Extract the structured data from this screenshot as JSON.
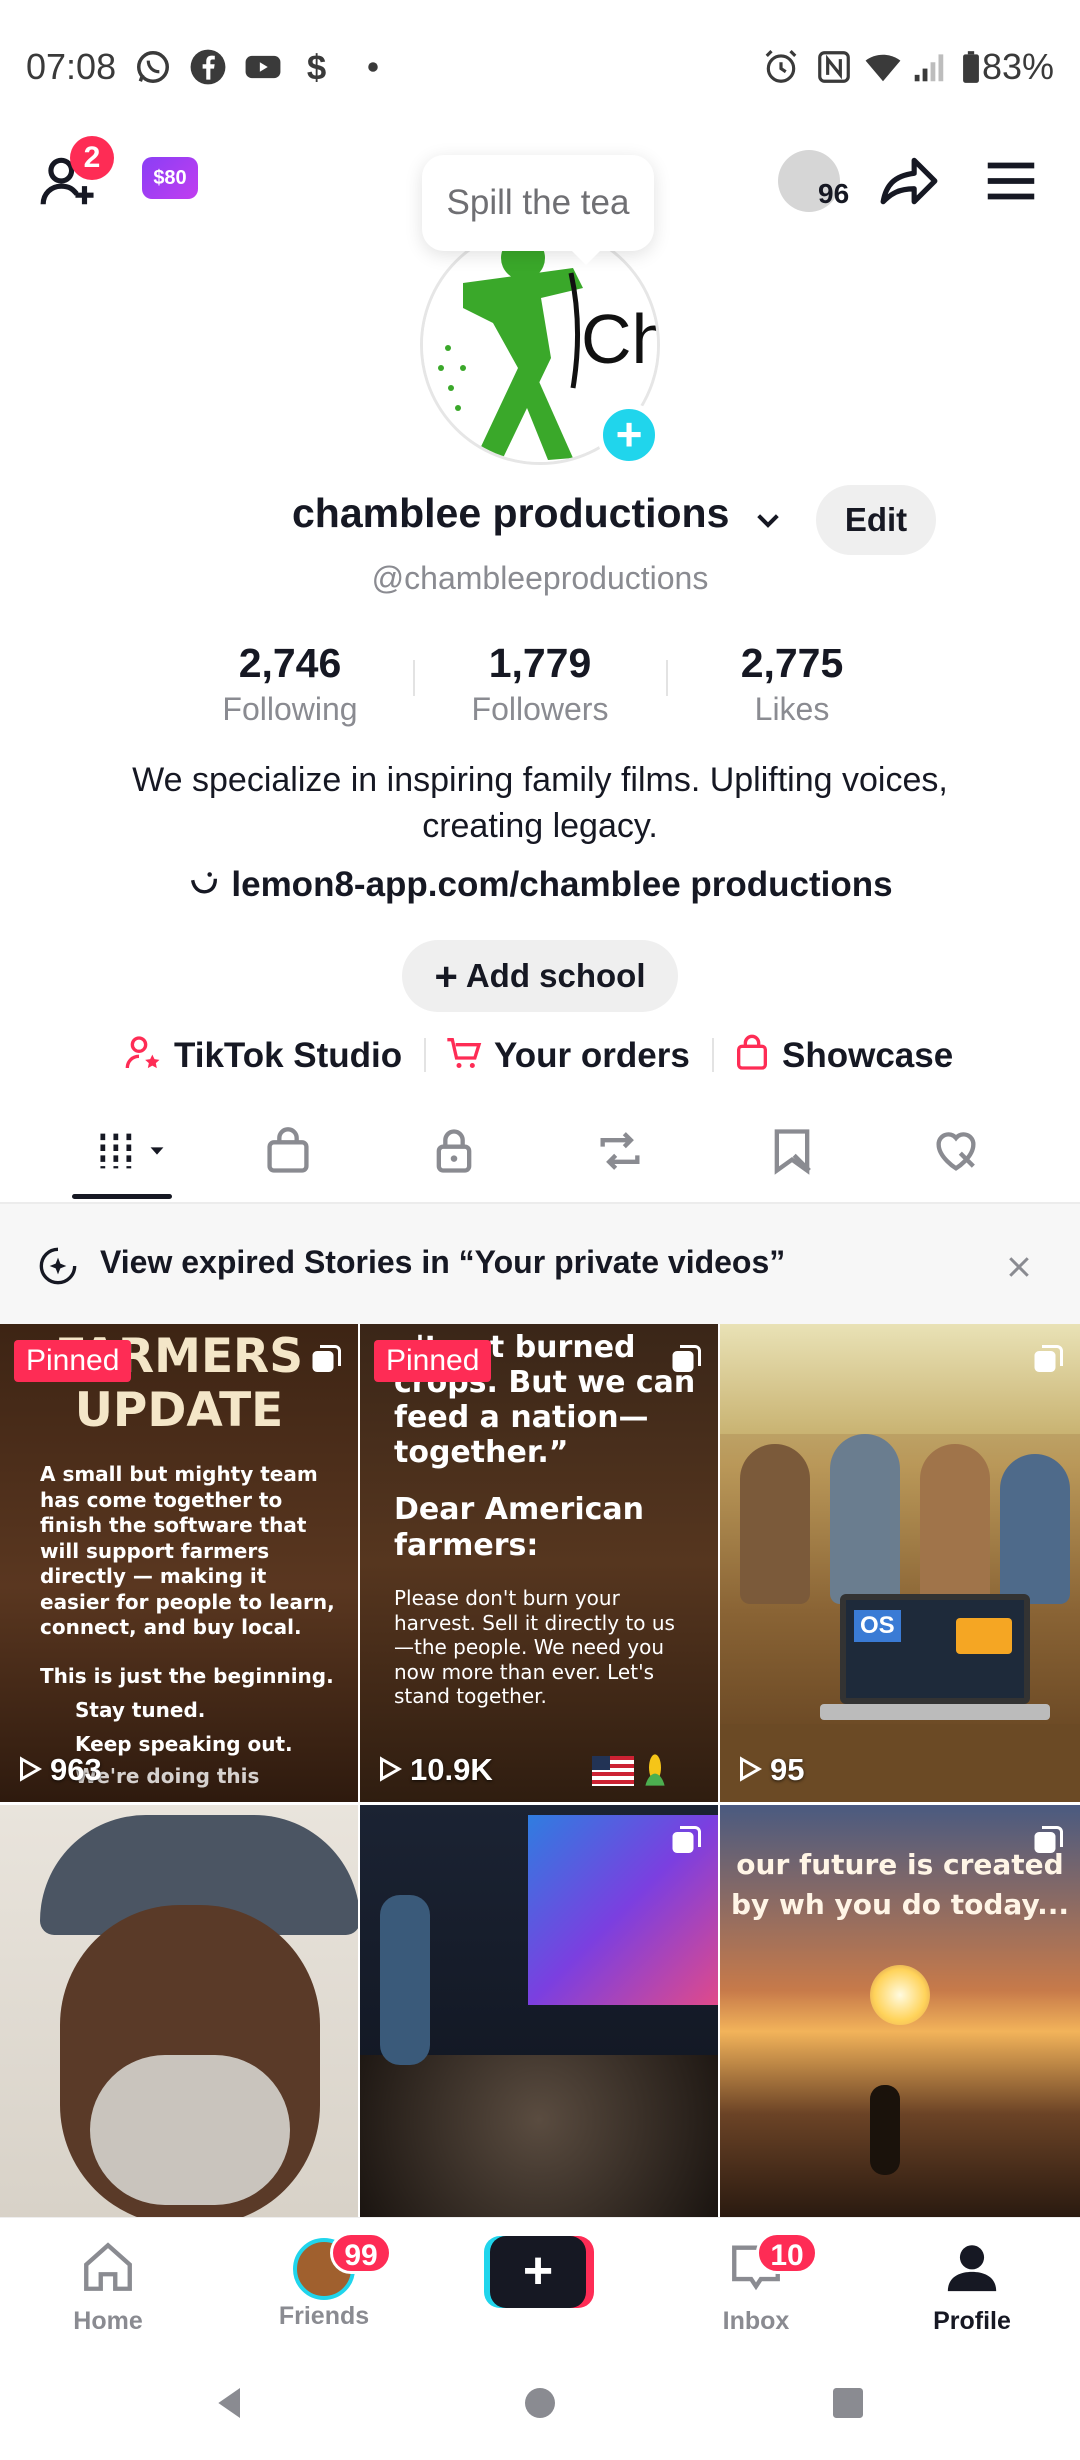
{
  "status_bar": {
    "time": "07:08",
    "battery": "83%"
  },
  "header": {
    "add_friends_badge": "2",
    "coin_badge": "$80",
    "views_count": "96",
    "tooltip": "Spill the tea"
  },
  "profile": {
    "name": "chamblee productions",
    "edit_label": "Edit",
    "handle": "@chambleeproductions",
    "stats": [
      {
        "value": "2,746",
        "label": "Following"
      },
      {
        "value": "1,779",
        "label": "Followers"
      },
      {
        "value": "2,775",
        "label": "Likes"
      }
    ],
    "bio": "We specialize in inspiring family films. Uplifting voices, creating legacy.",
    "link": "lemon8-app.com/chamblee productions",
    "add_school": "Add school",
    "quick_links": [
      "TikTok Studio",
      "Your orders",
      "Showcase"
    ]
  },
  "tabs": [
    "videos-grid-icon",
    "shop-bag-icon",
    "lock-icon",
    "repost-icon",
    "favorites-icon",
    "liked-hidden-icon"
  ],
  "notice": {
    "text": "View expired Stories in “Your private videos”"
  },
  "videos": [
    {
      "pinned": "Pinned",
      "views": "963",
      "headline": "FARMERS UPDATE",
      "body": "A small but mighty team has come together to finish the software that will support farmers directly — making it easier for people to learn, connect, and buy local.",
      "footer1": "This is just the beginning.",
      "footer2": "Stay tuned.",
      "footer3": "Keep speaking out.",
      "footer4": "We're doing this"
    },
    {
      "pinned": "Pinned",
      "views": "10.9K",
      "headline": "n't eat burned crops. But we can feed a nation—together.”",
      "subhead": "Dear American farmers:",
      "body": "Please don't burn your harvest. Sell it directly to us—the people. We need you now more than ever. Let's stand together."
    },
    {
      "views": "95",
      "laptop_text": "OS"
    },
    {},
    {},
    {
      "caption": "our future is created by wh you do today..."
    }
  ],
  "bottom_nav": [
    {
      "label": "Home"
    },
    {
      "label": "Friends",
      "badge": "99"
    },
    {
      "label": ""
    },
    {
      "label": "Inbox",
      "badge": "10"
    },
    {
      "label": "Profile"
    }
  ],
  "colors": {
    "brand_red": "#fe2c55",
    "brand_cyan": "#20d5ec",
    "text_primary": "#161823",
    "text_secondary": "#8a8b91"
  }
}
